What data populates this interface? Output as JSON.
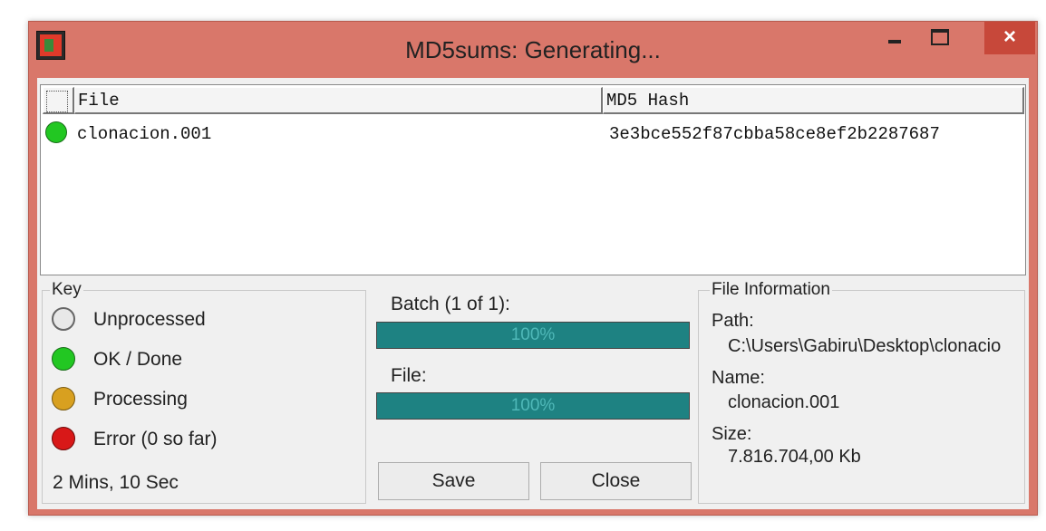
{
  "window": {
    "title": "MD5sums: Generating...",
    "close_glyph": "×"
  },
  "list": {
    "columns": [
      "File",
      "MD5 Hash"
    ],
    "rows": [
      {
        "status": "done",
        "status_color": "#22c722",
        "file": "clonacion.001",
        "hash": "3e3bce552f87cbba58ce8ef2b2287687"
      }
    ]
  },
  "key": {
    "title": "Key",
    "items": [
      {
        "label": "Unprocessed",
        "color": "#e8e8e8"
      },
      {
        "label": "OK / Done",
        "color": "#22c722"
      },
      {
        "label": "Processing",
        "color": "#d8a020"
      },
      {
        "label": "Error (0 so far)",
        "color": "#d81818"
      }
    ],
    "elapsed": "2 Mins, 10 Sec"
  },
  "progress": {
    "batch_label": "Batch (1 of 1):",
    "batch_percent": 100,
    "batch_text": "100%",
    "file_label": "File:",
    "file_percent": 100,
    "file_text": "100%"
  },
  "buttons": {
    "save": "Save",
    "close": "Close"
  },
  "file_info": {
    "title": "File Information",
    "path_label": "Path:",
    "path": "C:\\Users\\Gabiru\\Desktop\\clonacio",
    "name_label": "Name:",
    "name": "clonacion.001",
    "size_label": "Size:",
    "size": "7.816.704,00 Kb"
  },
  "colors": {
    "titlebar": "#d9776a",
    "progress": "#1e8282",
    "close_button": "#c7483a"
  }
}
